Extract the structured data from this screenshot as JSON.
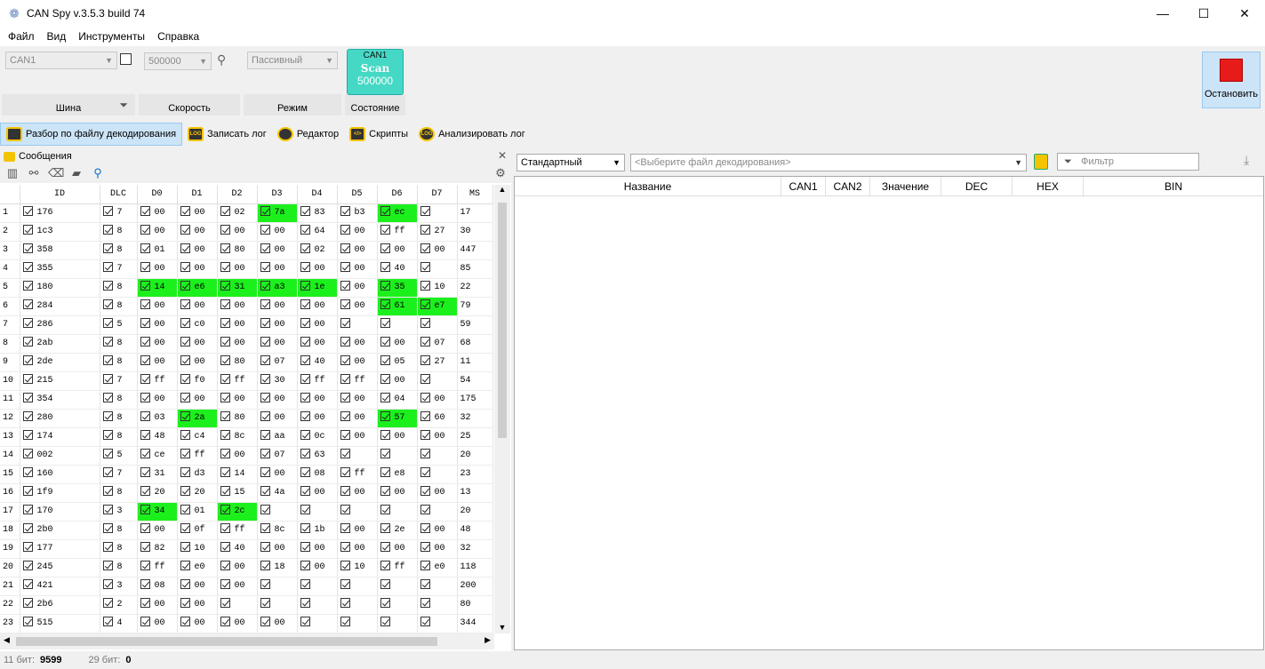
{
  "window": {
    "title": "CAN Spy v.3.5.3 build 74"
  },
  "menu": [
    "Файл",
    "Вид",
    "Инструменты",
    "Справка"
  ],
  "toolbar": {
    "bus": {
      "value": "CAN1",
      "label": "Шина"
    },
    "speed": {
      "value": "500000",
      "label": "Скорость"
    },
    "mode": {
      "value": "Пассивный",
      "label": "Режим"
    },
    "state": {
      "label": "Состояние",
      "line1": "CAN1",
      "line2": "Scan",
      "line3": "500000"
    },
    "stop_label": "Остановить"
  },
  "actions": [
    "Разбор по файлу декодирования",
    "Записать лог",
    "Редактор",
    "Скрипты",
    "Анализировать лог"
  ],
  "action_icons": [
    "LOG",
    "LOG",
    "",
    "</>",
    "LOG"
  ],
  "messages": {
    "title": "Сообщения",
    "columns": [
      "",
      "ID",
      "DLC",
      "D0",
      "D1",
      "D2",
      "D3",
      "D4",
      "D5",
      "D6",
      "D7",
      "MS"
    ],
    "rows": [
      [
        "1",
        "176",
        "7",
        "00",
        "00",
        "02",
        "7a",
        "83",
        "b3",
        "ec",
        "",
        "17"
      ],
      [
        "2",
        "1c3",
        "8",
        "00",
        "00",
        "00",
        "00",
        "64",
        "00",
        "ff",
        "27",
        "30"
      ],
      [
        "3",
        "358",
        "8",
        "01",
        "00",
        "80",
        "00",
        "02",
        "00",
        "00",
        "00",
        "447"
      ],
      [
        "4",
        "355",
        "7",
        "00",
        "00",
        "00",
        "00",
        "00",
        "00",
        "40",
        "",
        "85"
      ],
      [
        "5",
        "180",
        "8",
        "14",
        "e6",
        "31",
        "a3",
        "1e",
        "00",
        "35",
        "10",
        "22"
      ],
      [
        "6",
        "284",
        "8",
        "00",
        "00",
        "00",
        "00",
        "00",
        "00",
        "61",
        "e7",
        "79"
      ],
      [
        "7",
        "286",
        "5",
        "00",
        "c0",
        "00",
        "00",
        "00",
        "",
        "",
        "",
        "59"
      ],
      [
        "8",
        "2ab",
        "8",
        "00",
        "00",
        "00",
        "00",
        "00",
        "00",
        "00",
        "07",
        "68"
      ],
      [
        "9",
        "2de",
        "8",
        "00",
        "00",
        "80",
        "07",
        "40",
        "00",
        "05",
        "27",
        "11"
      ],
      [
        "10",
        "215",
        "7",
        "ff",
        "f0",
        "ff",
        "30",
        "ff",
        "ff",
        "00",
        "",
        "54"
      ],
      [
        "11",
        "354",
        "8",
        "00",
        "00",
        "00",
        "00",
        "00",
        "00",
        "04",
        "00",
        "175"
      ],
      [
        "12",
        "280",
        "8",
        "03",
        "2a",
        "80",
        "00",
        "00",
        "00",
        "57",
        "60",
        "32"
      ],
      [
        "13",
        "174",
        "8",
        "48",
        "c4",
        "8c",
        "aa",
        "0c",
        "00",
        "00",
        "00",
        "25"
      ],
      [
        "14",
        "002",
        "5",
        "ce",
        "ff",
        "00",
        "07",
        "63",
        "",
        "",
        "",
        "20"
      ],
      [
        "15",
        "160",
        "7",
        "31",
        "d3",
        "14",
        "00",
        "08",
        "ff",
        "e8",
        "",
        "23"
      ],
      [
        "16",
        "1f9",
        "8",
        "20",
        "20",
        "15",
        "4a",
        "00",
        "00",
        "00",
        "00",
        "13"
      ],
      [
        "17",
        "170",
        "3",
        "34",
        "01",
        "2c",
        "",
        "",
        "",
        "",
        "",
        "20"
      ],
      [
        "18",
        "2b0",
        "8",
        "00",
        "0f",
        "ff",
        "8c",
        "1b",
        "00",
        "2e",
        "00",
        "48"
      ],
      [
        "19",
        "177",
        "8",
        "82",
        "10",
        "40",
        "00",
        "00",
        "00",
        "00",
        "00",
        "32"
      ],
      [
        "20",
        "245",
        "8",
        "ff",
        "e0",
        "00",
        "18",
        "00",
        "10",
        "ff",
        "e0",
        "118"
      ],
      [
        "21",
        "421",
        "3",
        "08",
        "00",
        "00",
        "",
        "",
        "",
        "",
        "",
        "200"
      ],
      [
        "22",
        "2b6",
        "2",
        "00",
        "00",
        "",
        "",
        "",
        "",
        "",
        "",
        "80"
      ],
      [
        "23",
        "515",
        "4",
        "00",
        "00",
        "00",
        "00",
        "",
        "",
        "",
        "",
        "344"
      ]
    ],
    "highlights": [
      [
        0,
        2,
        0,
        0,
        0,
        1,
        0,
        0,
        1,
        0
      ],
      [
        0,
        0,
        0,
        0,
        0,
        0,
        0,
        0,
        0,
        0
      ],
      [
        0,
        0,
        0,
        0,
        0,
        0,
        0,
        0,
        0,
        0
      ],
      [
        0,
        0,
        0,
        0,
        0,
        0,
        0,
        0,
        0,
        0
      ],
      [
        0,
        0,
        1,
        1,
        1,
        1,
        1,
        0,
        1,
        0
      ],
      [
        0,
        0,
        0,
        0,
        0,
        0,
        0,
        0,
        1,
        1
      ],
      [
        0,
        0,
        0,
        0,
        0,
        0,
        0,
        0,
        0,
        0
      ],
      [
        0,
        0,
        0,
        0,
        0,
        0,
        0,
        0,
        0,
        0
      ],
      [
        0,
        0,
        0,
        0,
        0,
        0,
        0,
        0,
        0,
        0
      ],
      [
        0,
        0,
        0,
        0,
        0,
        0,
        0,
        0,
        0,
        0
      ],
      [
        0,
        0,
        0,
        0,
        0,
        0,
        0,
        0,
        0,
        0
      ],
      [
        0,
        0,
        0,
        1,
        0,
        0,
        0,
        0,
        1,
        0
      ],
      [
        0,
        0,
        0,
        0,
        0,
        0,
        0,
        0,
        0,
        0
      ],
      [
        0,
        0,
        0,
        0,
        0,
        0,
        0,
        0,
        0,
        0
      ],
      [
        0,
        0,
        0,
        0,
        0,
        0,
        0,
        0,
        0,
        0
      ],
      [
        0,
        0,
        0,
        0,
        0,
        0,
        0,
        0,
        0,
        0
      ],
      [
        0,
        0,
        1,
        0,
        1,
        0,
        0,
        0,
        0,
        0
      ],
      [
        0,
        0,
        0,
        0,
        0,
        0,
        0,
        0,
        0,
        0
      ],
      [
        0,
        0,
        0,
        0,
        0,
        0,
        0,
        0,
        0,
        0
      ],
      [
        0,
        0,
        0,
        0,
        0,
        0,
        0,
        0,
        0,
        0
      ],
      [
        0,
        0,
        0,
        0,
        0,
        0,
        0,
        0,
        0,
        0
      ],
      [
        0,
        0,
        0,
        0,
        0,
        0,
        0,
        0,
        0,
        0
      ],
      [
        0,
        0,
        0,
        0,
        0,
        0,
        0,
        0,
        0,
        0
      ]
    ],
    "highlight_color": "#1cf01c"
  },
  "decode": {
    "standard": "Стандартный",
    "file_placeholder": "<Выберите файл декодирования>",
    "filter_placeholder": "Фильтр",
    "columns": [
      "Название",
      "CAN1",
      "CAN2",
      "Значение",
      "DEC",
      "HEX",
      "BIN"
    ]
  },
  "status": {
    "bits11_label": "11 бит:",
    "bits11_value": "9599",
    "bits29_label": "29 бит:",
    "bits29_value": "0"
  }
}
